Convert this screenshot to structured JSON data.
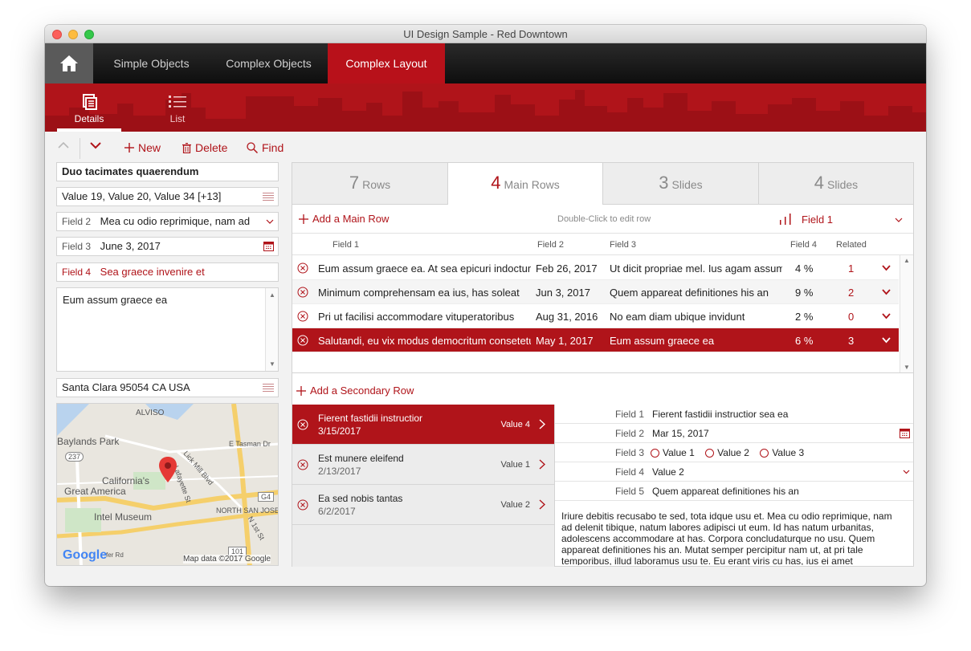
{
  "window": {
    "title": "UI Design Sample - Red Downtown"
  },
  "nav": {
    "tabs": [
      {
        "label": "Simple Objects"
      },
      {
        "label": "Complex Objects"
      },
      {
        "label": "Complex Layout"
      }
    ],
    "active_tab": "Complex Layout"
  },
  "views": {
    "details_label": "Details",
    "list_label": "List"
  },
  "toolbar": {
    "new_label": "New",
    "delete_label": "Delete",
    "find_label": "Find"
  },
  "record": {
    "title": "Duo tacimates quaerendum",
    "values_list": "Value 19, Value 20, Value 34 [+13]",
    "field2_label": "Field 2",
    "field2_value": "Mea cu odio reprimique, nam ad",
    "field3_label": "Field 3",
    "field3_value": "June 3, 2017",
    "field4_label": "Field 4",
    "field4_value": "Sea graece invenire et",
    "notes": "Eum assum graece ea",
    "address": "Santa Clara 95054 CA USA"
  },
  "map": {
    "labels": [
      "ALVISO",
      "Baylands Park",
      "E Tasman Dr",
      "California's",
      "Great America",
      "Lick Mill Blvd",
      "NORTH SAN JOSE",
      "Intel Museum",
      "N 1st St",
      "Lafayette St"
    ],
    "shields": [
      "237",
      "G4",
      "101"
    ],
    "google": "Google",
    "attribution": "Map data ©2017 Google",
    "street": "fer Rd"
  },
  "tabs": [
    {
      "num": "7",
      "label": "Rows"
    },
    {
      "num": "4",
      "label": "Main Rows"
    },
    {
      "num": "3",
      "label": "Slides"
    },
    {
      "num": "4",
      "label": "Slides"
    }
  ],
  "main_grid": {
    "add_label": "Add a Main Row",
    "hint": "Double-Click to edit row",
    "sort_field": "Field 1",
    "columns": [
      "Field 1",
      "Field 2",
      "Field 3",
      "Field 4",
      "Related"
    ],
    "rows": [
      {
        "f1": "Eum assum graece ea. At sea epicuri indoctum",
        "f2": "Feb 26, 2017",
        "f3": "Ut dicit propriae mel. Ius agam assum",
        "f4": "4 %",
        "rel": "1"
      },
      {
        "f1": "Minimum comprehensam ea ius, has soleat",
        "f2": "Jun 3, 2017",
        "f3": "Quem appareat definitiones his an",
        "f4": "9 %",
        "rel": "2"
      },
      {
        "f1": "Pri ut facilisi accommodare vituperatoribus",
        "f2": "Aug 31, 2016",
        "f3": "No eam diam ubique invidunt",
        "f4": "2 %",
        "rel": "0"
      },
      {
        "f1": "Salutandi, eu vix modus democritum consetetur",
        "f2": "May 1, 2017",
        "f3": "Eum assum graece ea",
        "f4": "6 %",
        "rel": "3"
      }
    ]
  },
  "secondary": {
    "add_label": "Add a Secondary Row",
    "items": [
      {
        "title": "Fierent fastidii instructior",
        "date": "3/15/2017",
        "value": "Value 4"
      },
      {
        "title": "Est munere eleifend",
        "date": "2/13/2017",
        "value": "Value 1"
      },
      {
        "title": "Ea sed nobis tantas",
        "date": "6/2/2017",
        "value": "Value 2"
      }
    ],
    "form": {
      "f1_label": "Field 1",
      "f1_value": "Fierent fastidii instructior sea ea",
      "f2_label": "Field 2",
      "f2_value": "Mar 15, 2017",
      "f3_label": "Field 3",
      "f3_options": [
        "Value 1",
        "Value 2",
        "Value 3"
      ],
      "f4_label": "Field 4",
      "f4_value": "Value 2",
      "f5_label": "Field 5",
      "f5_value": "Quem appareat definitiones his an",
      "long_text": "Iriure debitis recusabo te sed, tota idque usu et. Mea cu odio reprimique, nam ad delenit tibique, natum labores adipisci ut eum. Id has natum urbanitas, adolescens accommodare at has. Corpora concludaturque no usu. Quem appareat definitiones his an. Mutat semper percipitur nam ut, at pri tale temporibus, illud laboramus usu te. Eu erant viris cu has, ius ei amet"
    }
  }
}
